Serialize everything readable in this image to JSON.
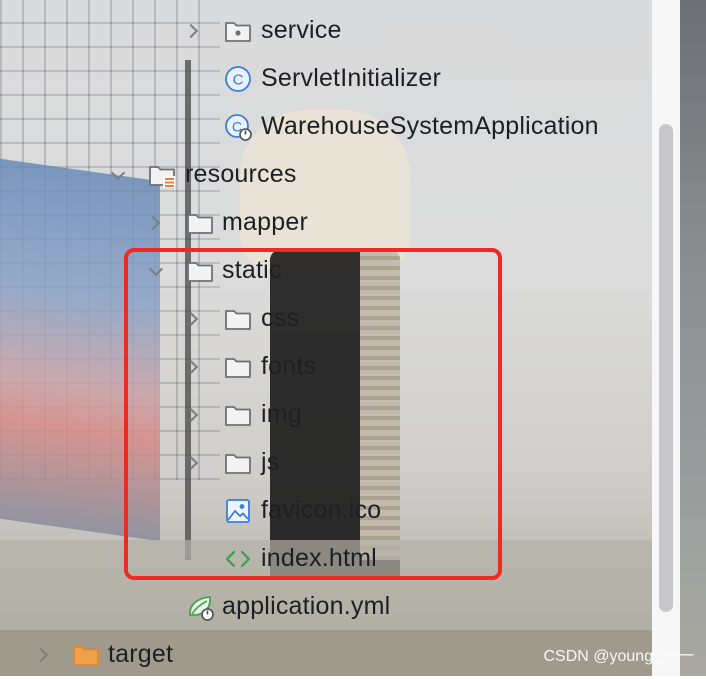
{
  "tree": {
    "items": [
      {
        "label": "service",
        "icon": "package-folder-icon",
        "expanded": false
      },
      {
        "label": "ServletInitializer",
        "icon": "java-class-icon"
      },
      {
        "label": "WarehouseSystemApplication",
        "icon": "spring-boot-class-icon"
      },
      {
        "label": "resources",
        "icon": "resources-folder-icon",
        "expanded": true
      },
      {
        "label": "mapper",
        "icon": "folder-icon",
        "expanded": false
      },
      {
        "label": "static",
        "icon": "folder-icon",
        "expanded": true
      },
      {
        "label": "css",
        "icon": "folder-icon",
        "expanded": false
      },
      {
        "label": "fonts",
        "icon": "folder-icon",
        "expanded": false
      },
      {
        "label": "img",
        "icon": "folder-icon",
        "expanded": false
      },
      {
        "label": "js",
        "icon": "folder-icon",
        "expanded": false
      },
      {
        "label": "favicon.ico",
        "icon": "image-file-icon"
      },
      {
        "label": "index.html",
        "icon": "html-file-icon"
      },
      {
        "label": "application.yml",
        "icon": "spring-config-file-icon"
      },
      {
        "label": "target",
        "icon": "excluded-folder-icon",
        "expanded": false
      }
    ]
  },
  "watermark": "CSDN @young_一一",
  "colors": {
    "highlight_border": "#ee2a24",
    "class_icon": "#3c7ddc",
    "html_icon": "#3f9c4a",
    "spring_icon": "#4aa14c",
    "excluded_folder": "#f0a04b",
    "resources_marker": "#e87c30"
  }
}
